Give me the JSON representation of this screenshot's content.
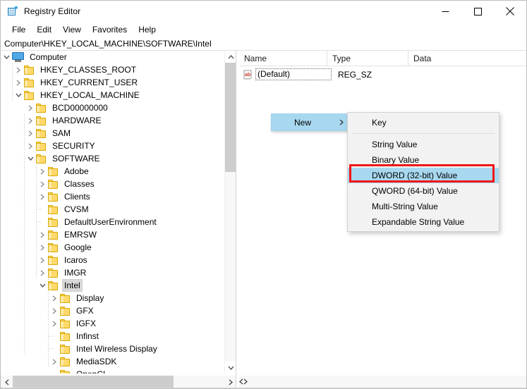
{
  "window": {
    "title": "Registry Editor",
    "icon": "registry-icon",
    "minimize_label": "Minimize",
    "maximize_label": "Maximize",
    "close_label": "Close"
  },
  "menubar": {
    "items": [
      {
        "label": "File"
      },
      {
        "label": "Edit"
      },
      {
        "label": "View"
      },
      {
        "label": "Favorites"
      },
      {
        "label": "Help"
      }
    ]
  },
  "address": {
    "path": "Computer\\HKEY_LOCAL_MACHINE\\SOFTWARE\\Intel"
  },
  "tree": {
    "nodes": [
      {
        "label": "Computer",
        "depth": 0,
        "twist": "down",
        "icon": "computer-icon",
        "selected": false
      },
      {
        "label": "HKEY_CLASSES_ROOT",
        "depth": 1,
        "twist": "right",
        "icon": "folder-icon",
        "selected": false
      },
      {
        "label": "HKEY_CURRENT_USER",
        "depth": 1,
        "twist": "right",
        "icon": "folder-icon",
        "selected": false
      },
      {
        "label": "HKEY_LOCAL_MACHINE",
        "depth": 1,
        "twist": "down",
        "icon": "folder-icon",
        "selected": false
      },
      {
        "label": "BCD00000000",
        "depth": 2,
        "twist": "right",
        "icon": "folder-icon",
        "selected": false
      },
      {
        "label": "HARDWARE",
        "depth": 2,
        "twist": "right",
        "icon": "folder-icon",
        "selected": false
      },
      {
        "label": "SAM",
        "depth": 2,
        "twist": "right",
        "icon": "folder-icon",
        "selected": false
      },
      {
        "label": "SECURITY",
        "depth": 2,
        "twist": "right",
        "icon": "folder-icon",
        "selected": false
      },
      {
        "label": "SOFTWARE",
        "depth": 2,
        "twist": "down",
        "icon": "folder-icon",
        "selected": false
      },
      {
        "label": "Adobe",
        "depth": 3,
        "twist": "right",
        "icon": "folder-icon",
        "selected": false
      },
      {
        "label": "Classes",
        "depth": 3,
        "twist": "right",
        "icon": "folder-icon",
        "selected": false
      },
      {
        "label": "Clients",
        "depth": 3,
        "twist": "right",
        "icon": "folder-icon",
        "selected": false
      },
      {
        "label": "CVSM",
        "depth": 3,
        "twist": "none",
        "icon": "folder-icon",
        "selected": false
      },
      {
        "label": "DefaultUserEnvironment",
        "depth": 3,
        "twist": "none",
        "icon": "folder-icon",
        "selected": false
      },
      {
        "label": "EMRSW",
        "depth": 3,
        "twist": "right",
        "icon": "folder-icon",
        "selected": false
      },
      {
        "label": "Google",
        "depth": 3,
        "twist": "right",
        "icon": "folder-icon",
        "selected": false
      },
      {
        "label": "Icaros",
        "depth": 3,
        "twist": "right",
        "icon": "folder-icon",
        "selected": false
      },
      {
        "label": "IMGR",
        "depth": 3,
        "twist": "right",
        "icon": "folder-icon",
        "selected": false
      },
      {
        "label": "Intel",
        "depth": 3,
        "twist": "down",
        "icon": "folder-icon",
        "selected": true
      },
      {
        "label": "Display",
        "depth": 4,
        "twist": "right",
        "icon": "folder-icon",
        "selected": false
      },
      {
        "label": "GFX",
        "depth": 4,
        "twist": "right",
        "icon": "folder-icon",
        "selected": false
      },
      {
        "label": "IGFX",
        "depth": 4,
        "twist": "right",
        "icon": "folder-icon",
        "selected": false
      },
      {
        "label": "Infinst",
        "depth": 4,
        "twist": "none",
        "icon": "folder-icon",
        "selected": false
      },
      {
        "label": "Intel Wireless Display",
        "depth": 4,
        "twist": "none",
        "icon": "folder-icon",
        "selected": false
      },
      {
        "label": "MediaSDK",
        "depth": 4,
        "twist": "right",
        "icon": "folder-icon",
        "selected": false
      },
      {
        "label": "OpenCL",
        "depth": 4,
        "twist": "none",
        "icon": "folder-icon",
        "selected": false
      }
    ]
  },
  "values": {
    "columns": [
      "Name",
      "Type",
      "Data"
    ],
    "rows": [
      {
        "name": "(Default)",
        "type": "REG_SZ",
        "data": "",
        "icon": "string-value-icon"
      }
    ]
  },
  "context_menu": {
    "parent_item": {
      "label": "New",
      "submenu_indicator": "chevron-right-icon"
    },
    "items": [
      {
        "label": "Key",
        "highlighted": false,
        "separator_after": true
      },
      {
        "label": "String Value",
        "highlighted": false,
        "separator_after": false
      },
      {
        "label": "Binary Value",
        "highlighted": false,
        "separator_after": false
      },
      {
        "label": "DWORD (32-bit) Value",
        "highlighted": true,
        "separator_after": false
      },
      {
        "label": "QWORD (64-bit) Value",
        "highlighted": false,
        "separator_after": false
      },
      {
        "label": "Multi-String Value",
        "highlighted": false,
        "separator_after": false
      },
      {
        "label": "Expandable String Value",
        "highlighted": false,
        "separator_after": false
      }
    ]
  },
  "annotation": {
    "type": "red-rectangle-highlight",
    "target_label": "DWORD (32-bit) Value",
    "color": "#f01515"
  },
  "colors": {
    "selection_blue": "#a8d8f0",
    "folder_yellow": "#ffd96b",
    "annotation_red": "#f01515",
    "tree_selection_gray": "#d9d9d9"
  },
  "scrollbars": {
    "tree_vertical": {
      "up_icon": "chevron-up-icon",
      "down_icon": "chevron-down-icon"
    },
    "tree_horizontal": {
      "left_icon": "chevron-left-icon",
      "right_icon": "chevron-right-icon"
    },
    "value_horizontal": {
      "left_icon": "chevron-left-icon",
      "right_icon": "chevron-right-icon"
    }
  }
}
